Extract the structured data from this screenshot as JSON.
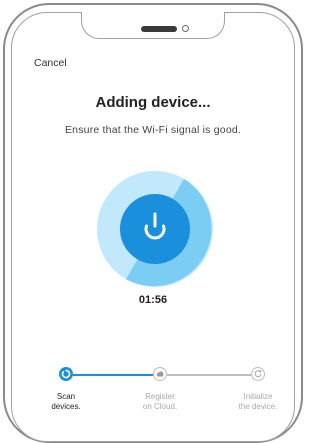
{
  "header": {
    "cancel_label": "Cancel"
  },
  "main": {
    "title": "Adding device...",
    "subtitle": "Ensure that the Wi-Fi signal is good.",
    "timer": "01:56"
  },
  "steps": [
    {
      "line1": "Scan",
      "line2": "devices.",
      "state": "active",
      "icon": "scan-spinner-icon"
    },
    {
      "line1": "Register",
      "line2": "on Cloud.",
      "state": "pending",
      "icon": "cloud-icon"
    },
    {
      "line1": "Initialize",
      "line2": "the device.",
      "state": "pending",
      "icon": "refresh-icon"
    }
  ],
  "colors": {
    "accent": "#1a8fdc",
    "accent_light": "#7ccdf3",
    "accent_pale": "#c2e9fb",
    "inactive": "#bdbdbd",
    "text_inactive": "#a8a8a8"
  }
}
